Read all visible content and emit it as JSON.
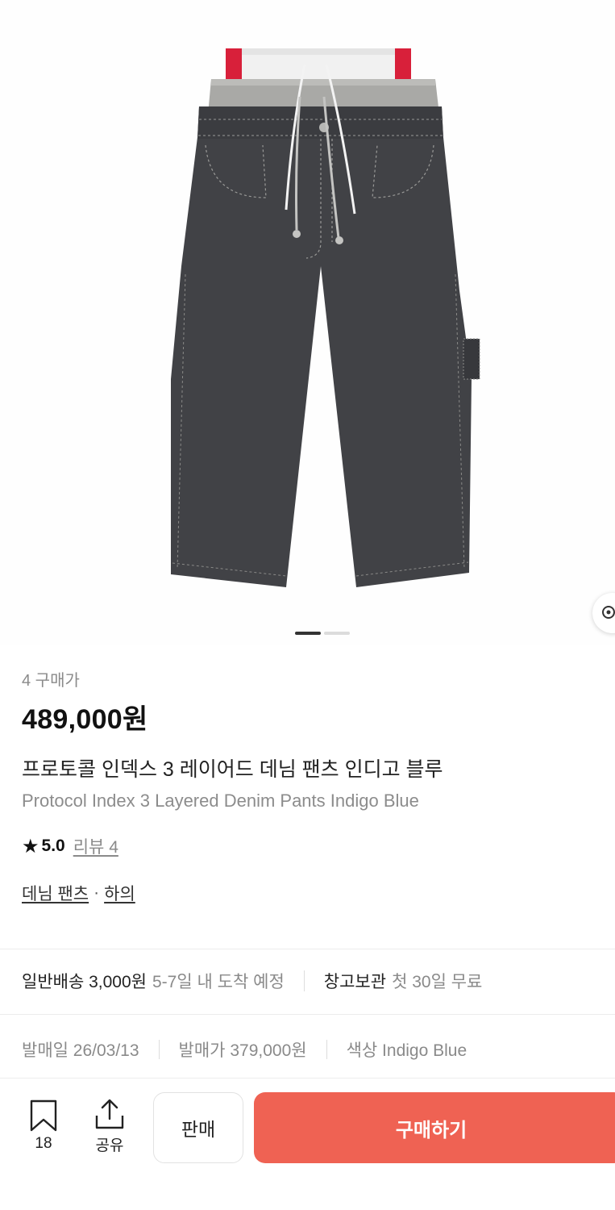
{
  "product": {
    "purchase_count": "4 구매가",
    "price": "489,000원",
    "name_ko": "프로토콜 인덱스 3 레이어드 데님 팬츠 인디고 블루",
    "name_en": "Protocol Index 3 Layered Denim Pants Indigo Blue",
    "rating_icon": "star-icon",
    "rating_score": "5.0",
    "review_link": "리뷰 4",
    "category": "데님 팬츠",
    "category_separator": "·",
    "subcategory": "하의"
  },
  "gallery": {
    "total_images": 2,
    "active_index": 0
  },
  "shipping": {
    "standard_label": "일반배송 3,000원",
    "standard_eta": "5-7일 내 도착 예정",
    "warehouse_label": "창고보관",
    "warehouse_note": "첫 30일 무료"
  },
  "meta": {
    "release_date": "발매일 26/03/13",
    "retail_price": "발매가 379,000원",
    "color": "색상 Indigo Blue"
  },
  "bottom_bar": {
    "bookmark_icon": "bookmark-icon",
    "bookmark_count": "18",
    "share_icon": "share-icon",
    "share_label": "공유",
    "sell_label": "판매",
    "buy_label": "구매하기",
    "buy_color": "#ef6253"
  }
}
